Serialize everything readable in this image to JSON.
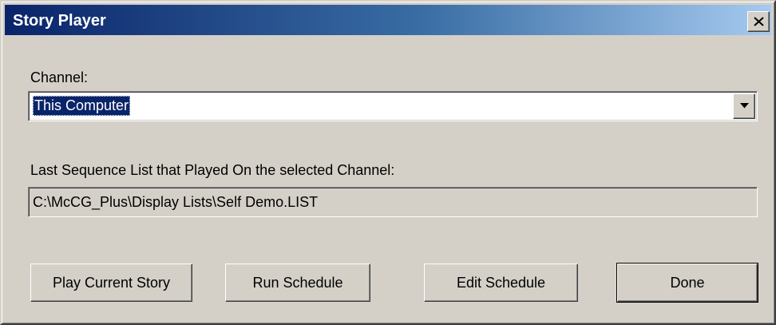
{
  "window": {
    "title": "Story Player"
  },
  "channel": {
    "label": "Channel:",
    "selected": "This Computer"
  },
  "last_sequence": {
    "label": "Last Sequence List that Played On the selected Channel:",
    "value": "C:\\McCG_Plus\\Display Lists\\Self Demo.LIST"
  },
  "buttons": {
    "play_current_story": "Play Current Story",
    "run_schedule": "Run Schedule",
    "edit_schedule": "Edit Schedule",
    "done": "Done"
  },
  "colors": {
    "titlebar_start": "#0a246a",
    "titlebar_end": "#a6caf0",
    "dialog_face": "#d4d0c8",
    "selection": "#0a246a"
  },
  "icons": {
    "close": "close-icon",
    "dropdown": "chevron-down-icon"
  }
}
